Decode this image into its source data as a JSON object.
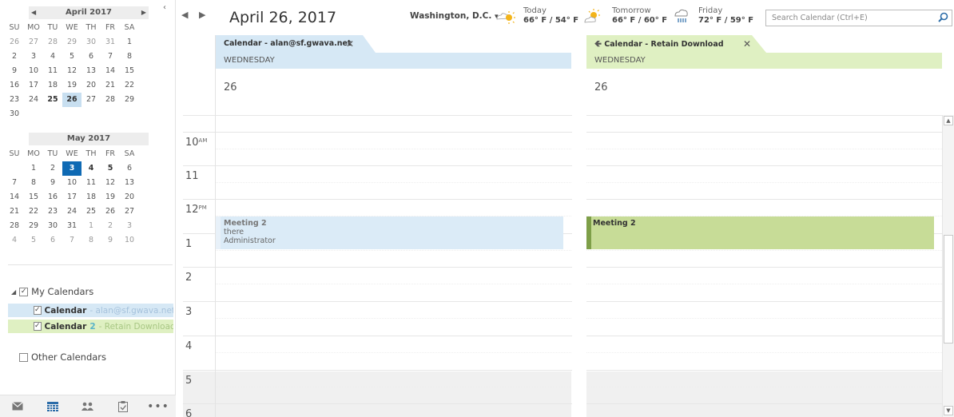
{
  "mini_april": {
    "title": "April 2017",
    "prev": "◀",
    "next": "▶",
    "dow": [
      "SU",
      "MO",
      "TU",
      "WE",
      "TH",
      "FR",
      "SA"
    ],
    "weeks": [
      [
        "26",
        "27",
        "28",
        "29",
        "30",
        "31",
        "1"
      ],
      [
        "2",
        "3",
        "4",
        "5",
        "6",
        "7",
        "8"
      ],
      [
        "9",
        "10",
        "11",
        "12",
        "13",
        "14",
        "15"
      ],
      [
        "16",
        "17",
        "18",
        "19",
        "20",
        "21",
        "22"
      ],
      [
        "23",
        "24",
        "25",
        "26",
        "27",
        "28",
        "29"
      ],
      [
        "30",
        "",
        "",
        "",
        "",
        "",
        ""
      ]
    ]
  },
  "mini_may": {
    "title": "May 2017",
    "dow": [
      "SU",
      "MO",
      "TU",
      "WE",
      "TH",
      "FR",
      "SA"
    ],
    "weeks": [
      [
        "",
        "1",
        "2",
        "3",
        "4",
        "5",
        "6"
      ],
      [
        "7",
        "8",
        "9",
        "10",
        "11",
        "12",
        "13"
      ],
      [
        "14",
        "15",
        "16",
        "17",
        "18",
        "19",
        "20"
      ],
      [
        "21",
        "22",
        "23",
        "24",
        "25",
        "26",
        "27"
      ],
      [
        "28",
        "29",
        "30",
        "31",
        "1",
        "2",
        "3"
      ],
      [
        "4",
        "5",
        "6",
        "7",
        "8",
        "9",
        "10"
      ]
    ]
  },
  "folders": {
    "my_calendars": "My Calendars",
    "cal1_name": "Calendar",
    "cal1_sub": " - alan@sf.gwava.net",
    "cal2_name": "Calendar",
    "cal2_num": " 2",
    "cal2_sub": " - Retain Download",
    "other_calendars": "Other Calendars"
  },
  "header": {
    "prev": "◀",
    "next": "▶",
    "date_title": "April 26, 2017",
    "location": "Washington, D.C.",
    "location_caret": "▾",
    "today_label": "Today",
    "today_temp": "66° F / 54° F",
    "tomorrow_label": "Tomorrow",
    "tomorrow_temp": "66° F / 60° F",
    "friday_label": "Friday",
    "friday_temp": "72° F / 59° F",
    "search_placeholder": "Search Calendar (Ctrl+E)"
  },
  "col1": {
    "tab": "Calendar - alan@sf.gwava.net",
    "close": "✕",
    "weekday": "WEDNESDAY",
    "day": "26",
    "appt_title": "Meeting 2",
    "appt_loc": "there",
    "appt_org": "Administrator"
  },
  "col2": {
    "tab": "Calendar - Retain Download",
    "close": "✕",
    "weekday": "WEDNESDAY",
    "day": "26",
    "appt_title": "Meeting 2"
  },
  "times": [
    {
      "h": "10",
      "ampm": "AM"
    },
    {
      "h": "11",
      "ampm": ""
    },
    {
      "h": "12",
      "ampm": "PM"
    },
    {
      "h": "1",
      "ampm": ""
    },
    {
      "h": "2",
      "ampm": ""
    },
    {
      "h": "3",
      "ampm": ""
    },
    {
      "h": "4",
      "ampm": ""
    },
    {
      "h": "5",
      "ampm": ""
    },
    {
      "h": "6",
      "ampm": ""
    }
  ],
  "colors": {
    "cal1_tab": "#d6e8f5",
    "cal2_tab": "#dff0c2",
    "cal1_appt": "#dbebf7",
    "cal2_appt": "#c7dc97",
    "cal2_appt_bar": "#7e9f48",
    "today_highlight": "#0f6ab4",
    "after_hours": "#f0f0f0"
  }
}
